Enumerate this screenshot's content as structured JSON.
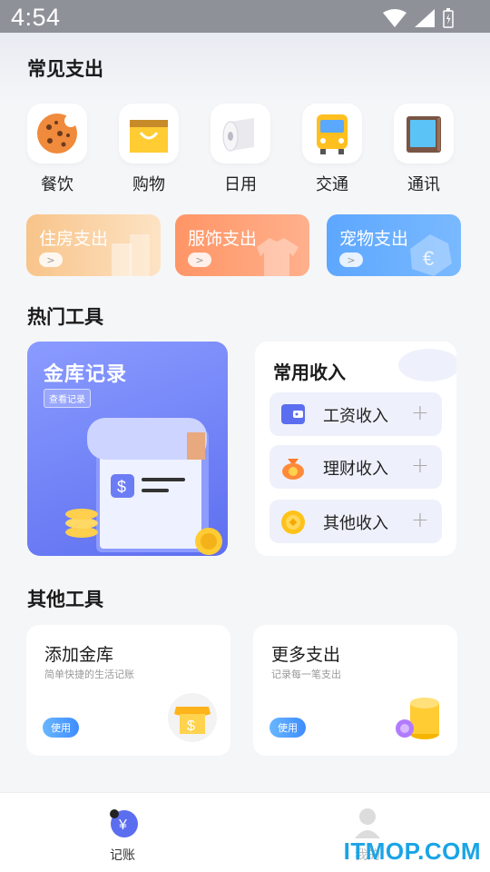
{
  "status": {
    "time": "4:54"
  },
  "common_expense": {
    "title": "常见支出",
    "categories": [
      {
        "label": "餐饮",
        "icon": "cookie-icon"
      },
      {
        "label": "购物",
        "icon": "shopping-bag-icon"
      },
      {
        "label": "日用",
        "icon": "tissue-roll-icon"
      },
      {
        "label": "交通",
        "icon": "bus-icon"
      },
      {
        "label": "通讯",
        "icon": "tablet-icon"
      }
    ],
    "cards": [
      {
        "label": "住房支出",
        "color": "#f7c68b"
      },
      {
        "label": "服饰支出",
        "color": "#ff8f5e"
      },
      {
        "label": "宠物支出",
        "color": "#5aa4ff"
      }
    ]
  },
  "hot_tools": {
    "title": "热门工具",
    "vault": {
      "title": "金库记录",
      "button": "查看记录"
    },
    "income": {
      "title": "常用收入",
      "items": [
        {
          "label": "工资收入",
          "icon": "wallet-icon",
          "plus": "+"
        },
        {
          "label": "理财收入",
          "icon": "money-bag-icon",
          "plus": "+"
        },
        {
          "label": "其他收入",
          "icon": "coin-icon",
          "plus": "+"
        }
      ]
    }
  },
  "other_tools": {
    "title": "其他工具",
    "cards": [
      {
        "title": "添加金库",
        "subtitle": "简单快捷的生活记账",
        "button": "使用"
      },
      {
        "title": "更多支出",
        "subtitle": "记录每一笔支出",
        "button": "使用"
      }
    ]
  },
  "tabbar": {
    "tabs": [
      {
        "label": "记账"
      },
      {
        "label": "我的"
      }
    ]
  },
  "watermark": "ITMOP.COM"
}
